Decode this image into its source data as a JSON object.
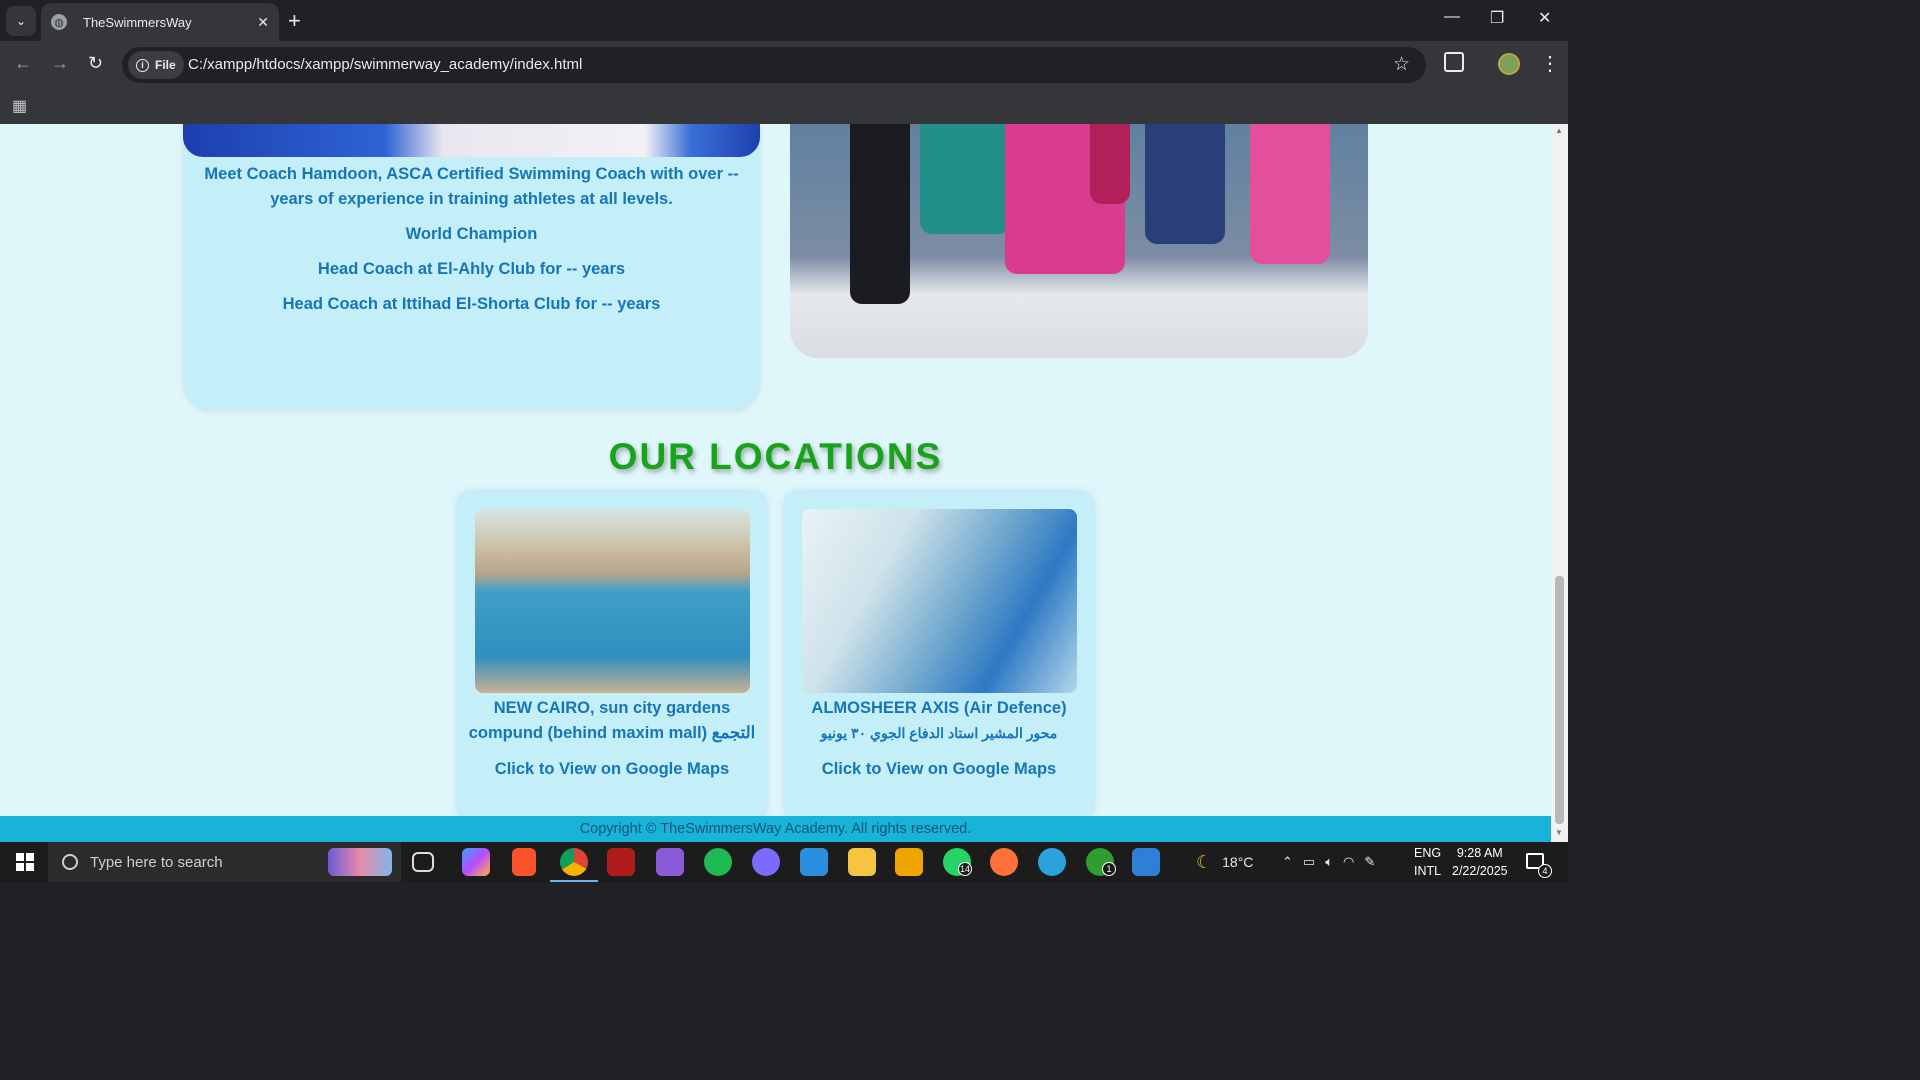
{
  "browser": {
    "tab_title": "TheSwimmersWay",
    "site_chip": "File",
    "url": "C:/xampp/htdocs/xampp/swimmerway_academy/index.html"
  },
  "coach": {
    "intro": "Meet Coach Hamdoon, ASCA Certified Swimming Coach with over -- years of experience in training athletes at all levels.",
    "achievements": [
      "World Champion",
      "Head Coach at El-Ahly Club for -- years",
      "Head Coach at Ittihad El-Shorta Club for -- years"
    ]
  },
  "locations": {
    "title": "OUR LOCATIONS",
    "items": [
      {
        "name": "NEW CAIRO, sun city gardens compund (behind maxim mall) التجمع",
        "arabic": "",
        "link": "Click to View on Google Maps"
      },
      {
        "name": "ALMOSHEER AXIS (Air Defence)",
        "arabic": "محور المشير استاد الدفاع الجوي ٣٠ يونيو",
        "link": "Click to View on Google Maps"
      }
    ]
  },
  "footer": {
    "copyright": "Copyright © TheSwimmersWay Academy. All rights reserved."
  },
  "taskbar": {
    "search_placeholder": "Type here to search",
    "weather": "18°C",
    "lang_top": "ENG",
    "lang_bottom": "INTL",
    "time": "9:28 AM",
    "date": "2/22/2025",
    "whatsapp_badge": "14",
    "xbox_badge": "1",
    "notification_count": "4"
  },
  "colors": {
    "page_bg": "#dff6fb",
    "card_bg": "#c4eef8",
    "text_blue": "#1676b8",
    "title_green": "#18a318",
    "footer_bg": "#17b3d8"
  }
}
